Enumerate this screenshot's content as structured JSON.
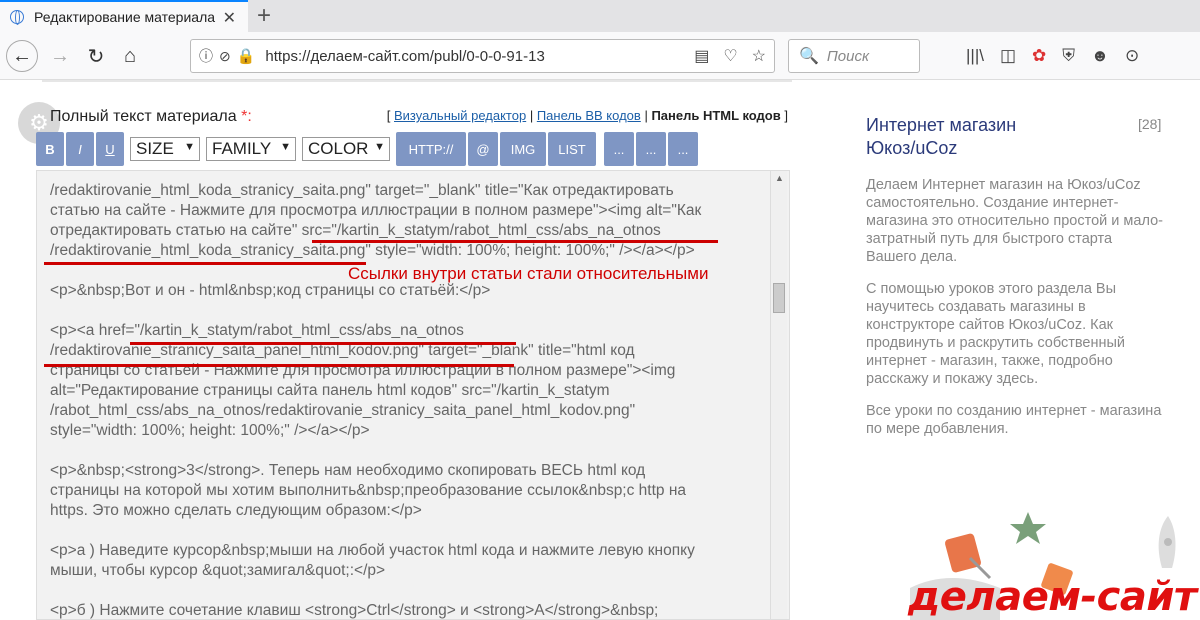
{
  "browser": {
    "tab_title": "Редактирование материала",
    "tab_close": "✕",
    "new_tab": "+",
    "url": "https://делаем-сайт.com/publ/0-0-0-91-13",
    "search_placeholder": "Поиск"
  },
  "form": {
    "label": "Полный текст материала",
    "required_mark": "*:",
    "links_open": "[",
    "link_visual": "Визуальный редактор",
    "sep1": "|",
    "link_bb": "Панель BB кодов",
    "sep2": "|",
    "current_panel": "Панель HTML кодов",
    "links_close": "]"
  },
  "toolbar": {
    "bold": "B",
    "italic": "I",
    "underline": "U",
    "size": "SIZE",
    "family": "FAMILY",
    "color": "COLOR",
    "http": "HTTP://",
    "at": "@",
    "img": "IMG",
    "list": "LIST",
    "more1": "...",
    "more2": "...",
    "more3": "..."
  },
  "code_lines": {
    "l1": "/redaktirovanie_html_koda_stranicy_saita.png\" target=\"_blank\" title=\"Как отредактировать",
    "l2": "статью на сайте - Нажмите для просмотра иллюстрации в полном размере\"><img alt=\"Как",
    "l3": "отредактировать статью на сайте\" src=\"/kartin_k_statym/rabot_html_css/abs_na_otnos",
    "l4": "/redaktirovanie_html_koda_stranicy_saita.png\" style=\"width: 100%; height: 100%;\" /></a></p>",
    "l5": "<p>&nbsp;Вот и он - html&nbsp;код страницы со статьёй:</p>",
    "l6": "<p><a href=\"/kartin_k_statym/rabot_html_css/abs_na_otnos",
    "l7": "/redaktirovanie_stranicy_saita_panel_html_kodov.png\" target=\"_blank\" title=\"html код",
    "l8": "страницы со статьей - Нажмите для просмотра иллюстрации в полном размере\"><img",
    "l9": "alt=\"Редактирование страницы сайта панель html кодов\" src=\"/kartin_k_statym",
    "l10": "/rabot_html_css/abs_na_otnos/redaktirovanie_stranicy_saita_panel_html_kodov.png\"",
    "l11": "style=\"width: 100%; height: 100%;\" /></a></p>",
    "l12": "<p>&nbsp;<strong>3</strong>. Теперь нам необходимо скопировать ВЕСЬ html код",
    "l13": "страницы на которой мы хотим выполнить&nbsp;преобразование ссылок&nbsp;с http на",
    "l14": "https. Это можно сделать следующим образом:</p>",
    "l15": "<p>а ) Наведите курсор&nbsp;мыши на любой участок html кода и нажмите левую кнопку",
    "l16": "мыши, чтобы курсор &quot;замигал&quot;:</p>",
    "l17": "<p>б ) Нажмите сочетание клавиш <strong>Ctrl</strong> и <strong>A</strong>&nbsp;"
  },
  "annotation": "Ссылки внутри статьи стали относительными",
  "sidebar": {
    "title": "Интернет магазин Юкоз/uCoz",
    "count": "[28]",
    "p1": "Делаем Интернет магазин на Юкоз/uCoz самостоятельно. Создание интернет-магазина это относительно простой и мало-затратный путь для быстрого старта Вашего дела.",
    "p2": "С помощью уроков этого раздела Вы научитесь создавать магазины в конструкторе сайтов Юкоз/uCoz. Как продвинуть и раскрутить собственный интернет - магазин, также, подробно расскажу и покажу здесь.",
    "p3": "Все уроки по созданию интернет - магазина по мере добавления."
  },
  "brand": "делаем-сайт"
}
